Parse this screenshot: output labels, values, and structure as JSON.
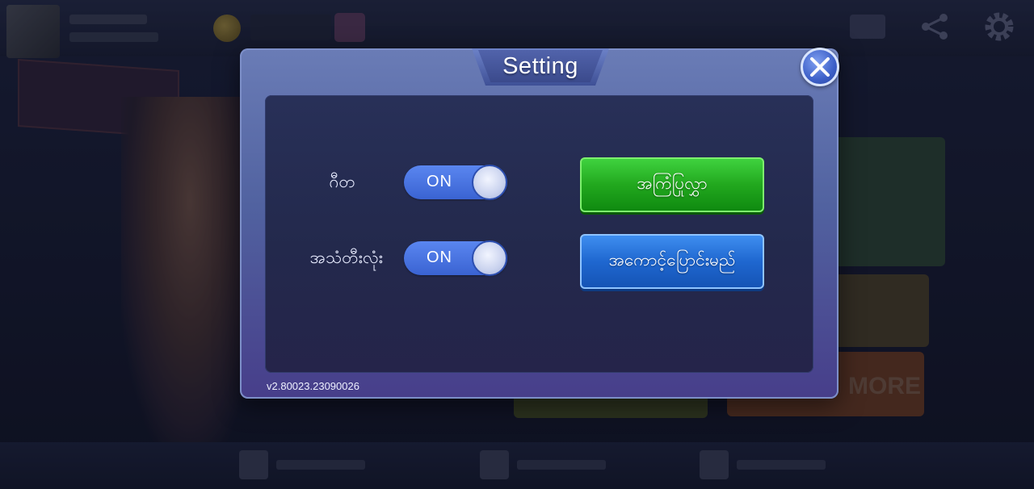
{
  "dialog": {
    "title": "Setting",
    "version": "v2.80023.23090026"
  },
  "settings": {
    "music_label": "ဂီတ",
    "music_state": "ON",
    "sound_label": "အသံတီးလုံး",
    "sound_state": "ON"
  },
  "buttons": {
    "logout_label": "အကြံပြုလွှာ",
    "switch_account_label": "အကောင့်ပြောင်းမည်"
  },
  "background": {
    "more_label": "MORE"
  },
  "colors": {
    "accent_blue": "#3a63d2",
    "logout_green": "#22a81e",
    "switch_blue": "#1f67d0",
    "dialog_frame": "#5162a0",
    "panel_dark": "#252b4e"
  },
  "icons": {
    "close": "close-icon",
    "mail": "mail-icon",
    "share": "share-icon",
    "settings": "gear-icon"
  }
}
